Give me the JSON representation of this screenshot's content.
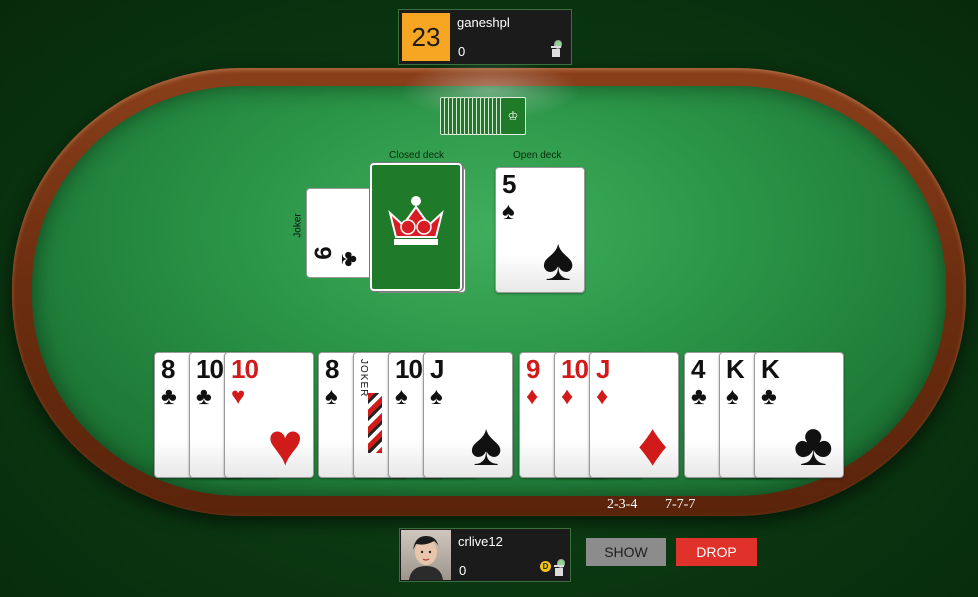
{
  "opponent": {
    "score": "23",
    "name": "ganeshpl",
    "value": "0"
  },
  "center": {
    "closed_deck_label": "Closed deck",
    "open_deck_label": "Open deck",
    "joker_label": "Joker",
    "joker_card": {
      "rank": "9",
      "suit": "♣"
    },
    "open_card": {
      "rank": "5",
      "suit": "♠"
    }
  },
  "hand": {
    "groups": [
      [
        {
          "rank": "8",
          "suit": "♣",
          "color": "black"
        },
        {
          "rank": "10",
          "suit": "♣",
          "color": "black"
        },
        {
          "rank": "10",
          "suit": "♥",
          "color": "red"
        }
      ],
      [
        {
          "rank": "8",
          "suit": "♠",
          "color": "black"
        },
        {
          "rank": "JOKER",
          "suit": "",
          "color": "black"
        },
        {
          "rank": "10",
          "suit": "♠",
          "color": "black"
        },
        {
          "rank": "J",
          "suit": "♠",
          "color": "black"
        }
      ],
      [
        {
          "rank": "9",
          "suit": "♦",
          "color": "red"
        },
        {
          "rank": "10",
          "suit": "♦",
          "color": "red"
        },
        {
          "rank": "J",
          "suit": "♦",
          "color": "red"
        }
      ],
      [
        {
          "rank": "4",
          "suit": "♣",
          "color": "black"
        },
        {
          "rank": "K",
          "suit": "♠",
          "color": "black"
        },
        {
          "rank": "K",
          "suit": "♣",
          "color": "black"
        }
      ]
    ]
  },
  "combos": {
    "left": "2-3-4",
    "right": "7-7-7"
  },
  "player": {
    "name": "crlive12",
    "value": "0",
    "dealer_badge": "D"
  },
  "actions": {
    "show_label": "SHOW",
    "drop_label": "DROP"
  }
}
